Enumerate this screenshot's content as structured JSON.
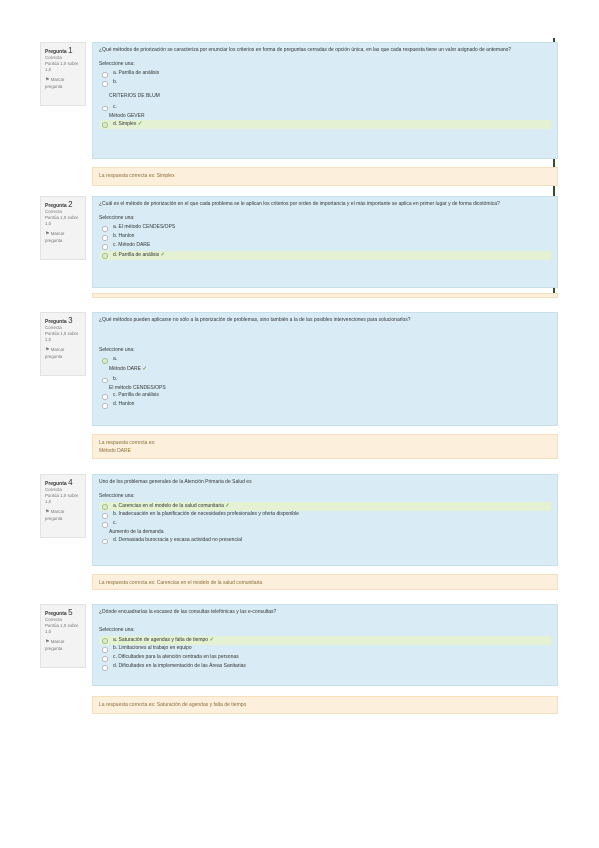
{
  "questions": [
    {
      "label": "Pregunta",
      "number": "1",
      "state": "Correcta",
      "grade": "Puntúa 1,0 sobre 1,0",
      "flag": "Marcar pregunta",
      "text": "¿Qué métodos de priorización se caracteriza por enunciar los criterios en forma de preguntas cerradas de opción única, en las que cada respuesta tiene un valor asignado de antemano?",
      "prompt": "Seleccione una:",
      "options": [
        "a. Parrilla de análisis",
        "b.",
        "c.",
        "d. Simplex"
      ],
      "extra_b": "CRITERIOS DE BLUM",
      "extra_c": "Método GEVER",
      "feedback": "La respuesta correcta es: Simplex"
    },
    {
      "label": "Pregunta",
      "number": "2",
      "state": "Correcta",
      "grade": "Puntúa 1,0 sobre 1,0",
      "flag": "Marcar pregunta",
      "text": "¿Cuál es el método de priorización en el que cada problema se le aplican los criterios por orden de importancia y el más importante se aplica en primer lugar y de forma dicotómica?",
      "prompt": "Seleccione una:",
      "options": [
        "a. El método CENDES/OPS",
        "b. Hanlon",
        "c. Método DARE",
        "d. Parrilla de análisis"
      ]
    },
    {
      "label": "Pregunta",
      "number": "3",
      "state": "Correcta",
      "grade": "Puntúa 1,0 sobre 1,0",
      "flag": "Marcar pregunta",
      "text": "¿Qué métodos pueden aplicarse no sólo a la priorización de problemas, sino también a la de las posibles intervenciones para solucionarlos?",
      "prompt": "Seleccione una:",
      "options": [
        "a.",
        "b.",
        "c. Parrilla de análisis",
        "d. Hanlon"
      ],
      "extra_a": "Método DARE",
      "extra_b": "El método CENDES/OPS",
      "feedback_line1": "La respuesta correcta es:",
      "feedback_line2": "Método DARE"
    },
    {
      "label": "Pregunta",
      "number": "4",
      "state": "Correcta",
      "grade": "Puntúa 1,0 sobre 1,0",
      "flag": "Marcar pregunta",
      "text": "Uno de los problemas generales de la Atención Primaria de Salud es",
      "prompt": "Seleccione una:",
      "options": [
        "a. Carencias en el modelo de la salud comunitaria",
        "b. Inadecuación en la planificación de necesidades profesionales y oferta disponible",
        "c.",
        "d. Demasiada burocracia y escasa actividad no presencial"
      ],
      "extra_c": "Aumento de la demanda",
      "feedback": "La respuesta correcta es: Carencias en el modelo de la salud comunitaria"
    },
    {
      "label": "Pregunta",
      "number": "5",
      "state": "Correcta",
      "grade": "Puntúa 1,0 sobre 1,0",
      "flag": "Marcar pregunta",
      "text": "¿Dónde encuadrarías la escasez de las consultas telefónicas y las e-consultas?",
      "prompt": "Seleccione una:",
      "options": [
        "a. Saturación de agendas y falta de tiempo",
        "b. Limitaciones al trabajo en equipo",
        "c. Dificultades para la atención centrada en las personas",
        "d. Dificultades en la implementación de las Áreas Sanitarias"
      ],
      "feedback": "La respuesta correcta es: Saturación de agendas y falta de tiempo"
    }
  ],
  "check_mark": "✓",
  "colors": {
    "formulation_bg": "#d9ecf5",
    "feedback_bg": "#fcefdc",
    "correct_bg": "#e4f1d3",
    "check": "#6aa84f"
  }
}
